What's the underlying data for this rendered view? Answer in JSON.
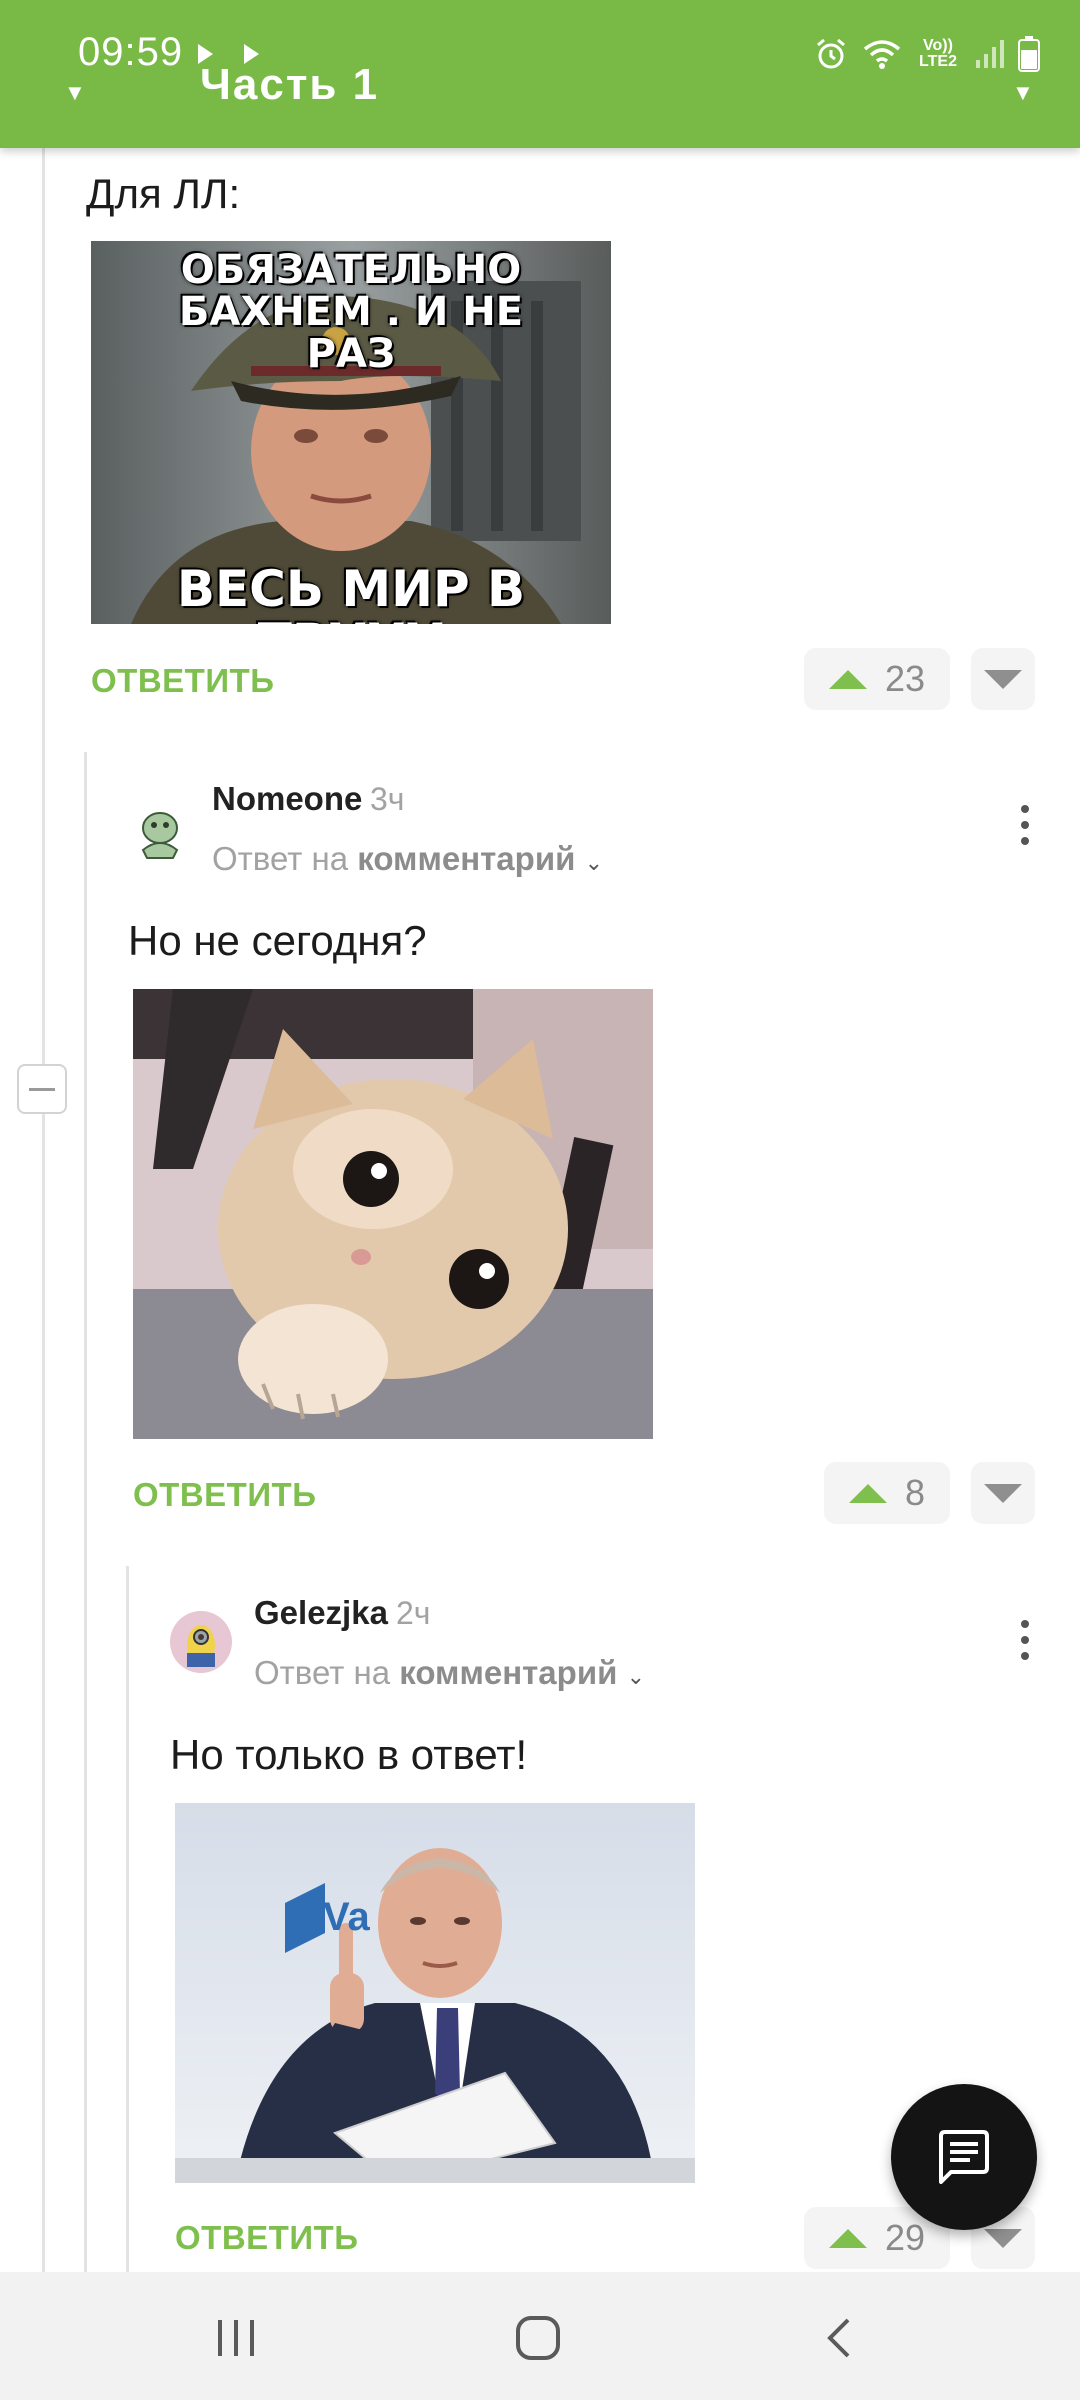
{
  "status_bar": {
    "time": "09:59",
    "network_label": "Vo)) LTE2",
    "icons": [
      "alarm-icon",
      "wifi-icon",
      "signal-icon",
      "battery-icon"
    ]
  },
  "header": {
    "title": "Часть 1"
  },
  "colors": {
    "accent": "#79b946",
    "reply_green": "#7fbf4e",
    "vote_bg": "#f4f4f4",
    "meta_gray": "#a2a2a2",
    "fab": "#141414"
  },
  "comments": [
    {
      "text": "Для ЛЛ:",
      "meme": {
        "top_text": "ОБЯЗАТЕЛЬНО БАХНЕМ . И НЕ РАЗ",
        "bottom_text": "ВЕСЬ МИР В ТРУХУ"
      },
      "reply_label": "ОТВЕТИТЬ",
      "votes": "23"
    },
    {
      "author": "Nomeone",
      "time": "3ч",
      "reply_prefix": "Ответ на",
      "reply_target": "комментарий",
      "text": "Но не сегодня?",
      "reply_label": "ОТВЕТИТЬ",
      "votes": "8"
    },
    {
      "author": "Gelezjka",
      "time": "2ч",
      "reply_prefix": "Ответ на",
      "reply_target": "комментарий",
      "text": "Но только в ответ!",
      "photo_logo_text": "Va",
      "reply_label": "ОТВЕТИТЬ",
      "votes": "29"
    }
  ],
  "nav": {
    "icons": [
      "recents-icon",
      "home-icon",
      "back-icon"
    ]
  }
}
